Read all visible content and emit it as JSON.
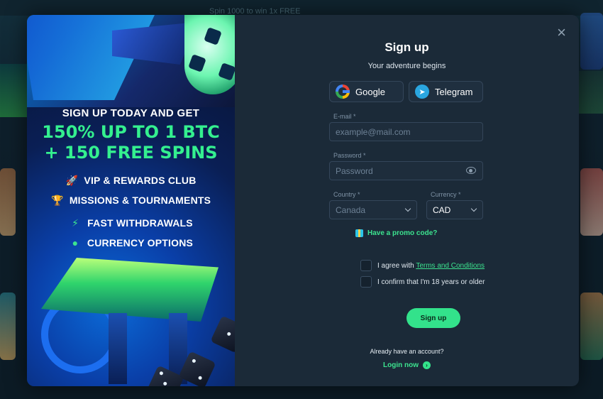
{
  "background": {
    "banner_text": "Spin 1000 to win 1x FREE"
  },
  "promo": {
    "headline": "SIGN UP TODAY AND GET",
    "offer_line1": "150% UP TO 1 BTC",
    "offer_line2": "+ 150 FREE SPINS",
    "features": [
      {
        "label": "VIP & REWARDS CLUB",
        "icon": "rocket-icon"
      },
      {
        "label": "MISSIONS & TOURNAMENTS",
        "icon": "trophy-icon"
      },
      {
        "label": "FAST WITHDRAWALS",
        "icon": "lightning-icon"
      },
      {
        "label": "CURRENCY OPTIONS",
        "icon": "coins-icon"
      }
    ]
  },
  "form": {
    "close_icon": "×",
    "title": "Sign up",
    "subtitle": "Your adventure begins",
    "social": {
      "google_label": "Google",
      "telegram_label": "Telegram"
    },
    "email": {
      "label": "E-mail *",
      "placeholder": "example@mail.com"
    },
    "password": {
      "label": "Password *",
      "placeholder": "Password"
    },
    "country": {
      "label": "Country *",
      "value": "Canada"
    },
    "currency": {
      "label": "Currency *",
      "value": "CAD"
    },
    "promo_code_link": "Have a promo code?",
    "agree_prefix": "I agree with",
    "terms_link": "Terms and Conditions",
    "age_confirm": "I confirm that I'm 18 years or older",
    "submit_label": "Sign up",
    "already_account": "Already have an account?",
    "login_link": "Login now",
    "colors": {
      "accent": "#33e28b",
      "panel": "#1b2a38",
      "input": "#1e2d3c"
    }
  }
}
